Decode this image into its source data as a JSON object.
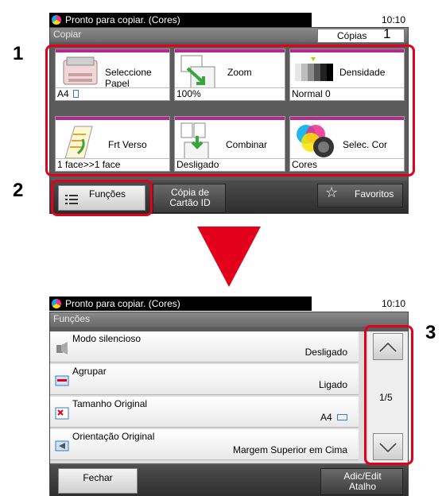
{
  "top": {
    "status": "Pronto para copiar. (Cores)",
    "time": "10:10",
    "mode": "Copiar",
    "copies_label": "Cópias",
    "copies_value": "1",
    "tiles": [
      {
        "label": "Seleccione Papel",
        "value": "A4",
        "icon": "paper-tray-icon"
      },
      {
        "label": "Zoom",
        "value": "100%",
        "icon": "zoom-icon"
      },
      {
        "label": "Densidade",
        "value": "Normal 0",
        "icon": "density-icon"
      },
      {
        "label": "Frt Verso",
        "value": "1 face>>1 face",
        "icon": "duplex-icon"
      },
      {
        "label": "Combinar",
        "value": "Desligado",
        "icon": "combine-icon"
      },
      {
        "label": "Selec. Cor",
        "value": "Cores",
        "icon": "color-select-icon"
      }
    ],
    "functions_button": "Funções",
    "id_card_button": "Cópia de Cartão ID",
    "favorites_button": "Favoritos"
  },
  "bottom": {
    "status": "Pronto para copiar. (Cores)",
    "time": "10:10",
    "title": "Funções",
    "rows": [
      {
        "label": "Modo silencioso",
        "value": "Desligado",
        "icon": "speaker-icon"
      },
      {
        "label": "Agrupar",
        "value": "Ligado",
        "icon": "collate-icon"
      },
      {
        "label": "Tamanho Original",
        "value": "A4",
        "icon": "original-size-icon"
      },
      {
        "label": "Orientação Original",
        "value": "Margem Superior em Cima",
        "icon": "orientation-icon"
      }
    ],
    "page_indicator": "1/5",
    "close_button": "Fechar",
    "shortcut_button": "Adic/Edit Atalho"
  },
  "callouts": [
    "1",
    "2",
    "3"
  ],
  "colors": {
    "accent_red": "#e3001b",
    "band_magenta": "#b4298f"
  }
}
